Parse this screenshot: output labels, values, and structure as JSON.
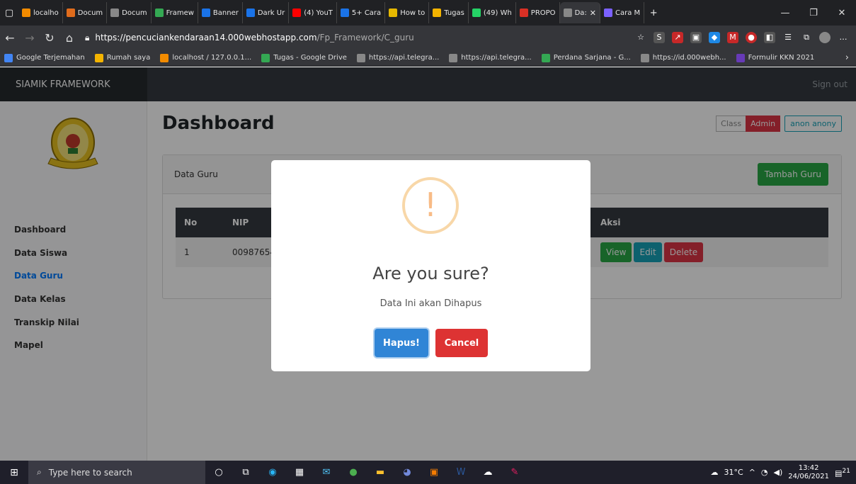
{
  "browser": {
    "tabs": [
      {
        "label": "localho",
        "color": "#f28b00"
      },
      {
        "label": "Docum",
        "color": "#e06c1c"
      },
      {
        "label": "Docum",
        "color": "#888888"
      },
      {
        "label": "Framew",
        "color": "#34a853"
      },
      {
        "label": "Banner",
        "color": "#1a73e8"
      },
      {
        "label": "Dark Ur",
        "color": "#1a73e8"
      },
      {
        "label": "(4) YouT",
        "color": "#ff0000"
      },
      {
        "label": "5+ Cara",
        "color": "#1a73e8"
      },
      {
        "label": "How to",
        "color": "#e6b800"
      },
      {
        "label": "Tugas",
        "color": "#f4b400"
      },
      {
        "label": "(49) Wh",
        "color": "#25d366"
      },
      {
        "label": "PROPO",
        "color": "#d93025"
      },
      {
        "label": "Da:",
        "color": "#888888",
        "active": true
      },
      {
        "label": "Cara M",
        "color": "#7b61ff"
      }
    ],
    "url_main": "https://pencuciankendaraan14.000webhostapp.com",
    "url_path": "/Fp_Framework/C_guru",
    "bookmarks": [
      {
        "label": "Google Terjemahan",
        "color": "#4285f4"
      },
      {
        "label": "Rumah saya",
        "color": "#f4b400"
      },
      {
        "label": "localhost / 127.0.0.1...",
        "color": "#f28b00"
      },
      {
        "label": "Tugas - Google Drive",
        "color": "#34a853"
      },
      {
        "label": "https://api.telegra...",
        "color": "#888888"
      },
      {
        "label": "https://api.telegra...",
        "color": "#888888"
      },
      {
        "label": "Perdana Sarjana - G...",
        "color": "#34a853"
      },
      {
        "label": "https://id.000webh...",
        "color": "#888888"
      },
      {
        "label": "Formulir KKN 2021",
        "color": "#673ab7"
      }
    ]
  },
  "app": {
    "brand": "SIAMIK FRAMEWORK",
    "signout": "Sign out",
    "sidebar": [
      "Dashboard",
      "Data Siswa",
      "Data Guru",
      "Data Kelas",
      "Transkip Nilai",
      "Mapel"
    ],
    "active_item": "Data Guru",
    "page_title": "Dashboard",
    "badge_class": "Class",
    "badge_admin": "Admin",
    "user": "anon anony",
    "card_title": "Data Guru",
    "add_button": "Tambah Guru",
    "table": {
      "headers": [
        "No",
        "NIP",
        "Aksi"
      ],
      "rows": [
        {
          "no": "1",
          "nip": "00987654"
        }
      ],
      "actions": [
        "View",
        "Edit",
        "Delete"
      ]
    }
  },
  "dialog": {
    "icon": "!",
    "title": "Are you sure?",
    "text": "Data Ini akan Dihapus",
    "confirm": "Hapus!",
    "cancel": "Cancel"
  },
  "taskbar": {
    "search_placeholder": "Type here to search",
    "temperature": "31°C",
    "time": "13:42",
    "date": "24/06/2021",
    "notifications": "21"
  }
}
